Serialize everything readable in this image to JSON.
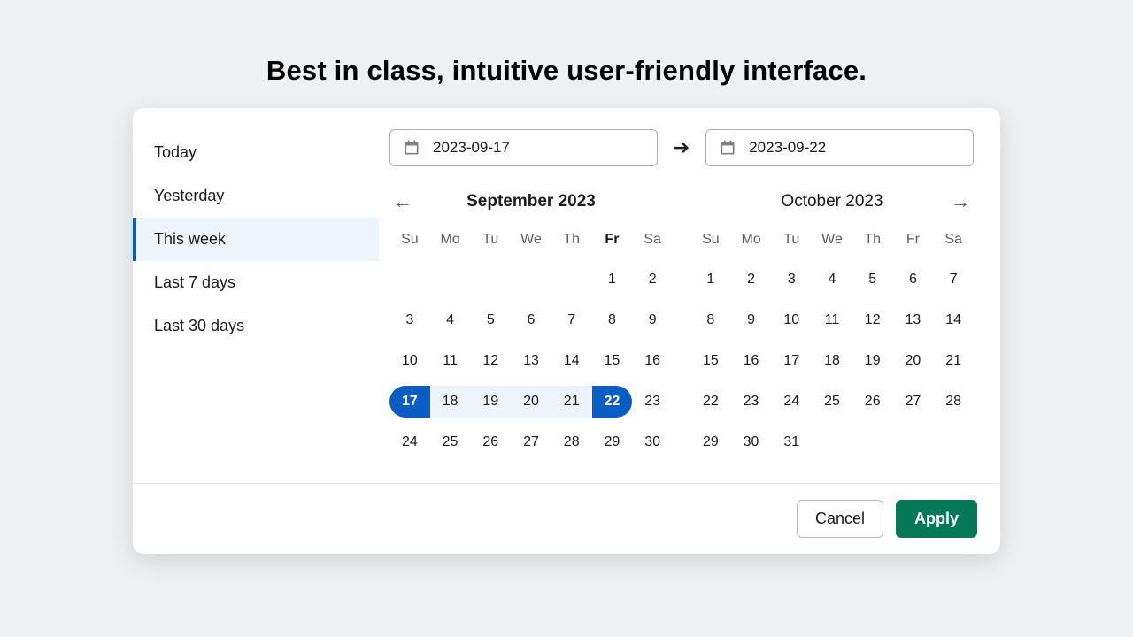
{
  "heading": "Best in class, intuitive user-friendly interface.",
  "presets": [
    {
      "label": "Today",
      "active": false
    },
    {
      "label": "Yesterday",
      "active": false
    },
    {
      "label": "This week",
      "active": true
    },
    {
      "label": "Last 7 days",
      "active": false
    },
    {
      "label": "Last 30 days",
      "active": false
    }
  ],
  "range": {
    "start": "2023-09-17",
    "end": "2023-09-22"
  },
  "dow": [
    "Su",
    "Mo",
    "Tu",
    "We",
    "Th",
    "Fr",
    "Sa"
  ],
  "dow_today_index": 5,
  "months": {
    "left": {
      "title": "September 2023",
      "title_bold": true,
      "blanks": 5,
      "days": 30,
      "range_start": 17,
      "range_end": 22
    },
    "right": {
      "title": "October 2023",
      "title_bold": false,
      "blanks": 0,
      "days": 31,
      "range_start": null,
      "range_end": null
    }
  },
  "footer": {
    "cancel": "Cancel",
    "apply": "Apply"
  },
  "colors": {
    "accent": "#0a5dc2",
    "apply": "#047857",
    "range_bg": "#eef4fb"
  }
}
